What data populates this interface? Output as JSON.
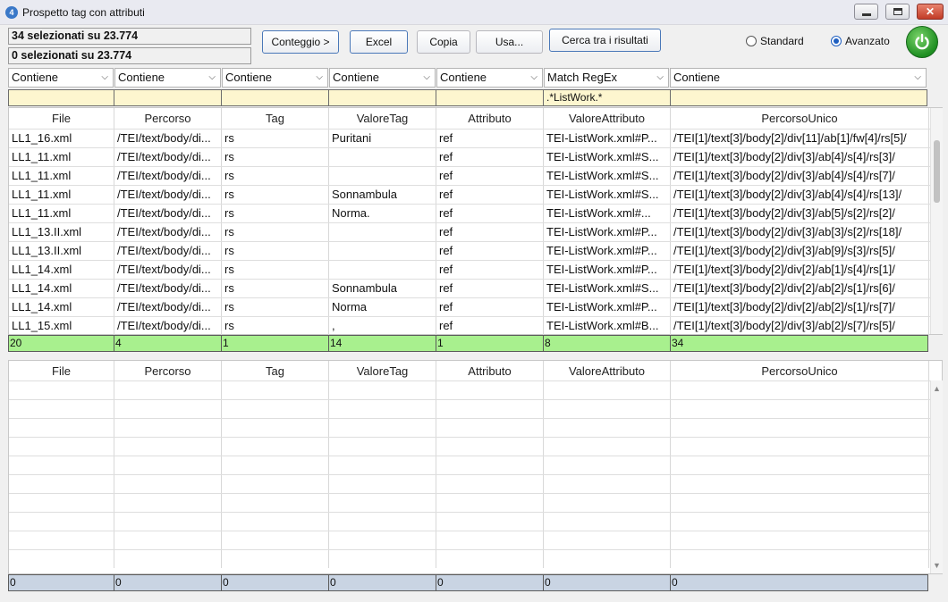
{
  "window": {
    "title": "Prospetto tag con attributi"
  },
  "status": {
    "selected_top": "34 selezionati su 23.774",
    "selected_bottom": "0 selezionati su 23.774"
  },
  "toolbar": {
    "count_label": "Conteggio >",
    "excel_label": "Excel",
    "copy_label": "Copia",
    "use_label": "Usa...",
    "search_results_label": "Cerca tra i risultati"
  },
  "mode": {
    "standard_label": "Standard",
    "advanced_label": "Avanzato",
    "selected": "Avanzato"
  },
  "filters": {
    "operators": [
      "Contiene",
      "Contiene",
      "Contiene",
      "Contiene",
      "Contiene",
      "Match RegEx",
      "Contiene"
    ],
    "values": [
      "",
      "",
      "",
      "",
      "",
      ".*ListWork.*",
      ""
    ]
  },
  "columns": [
    "File",
    "Percorso",
    "Tag",
    "ValoreTag",
    "Attributo",
    "ValoreAttributo",
    "PercorsoUnico"
  ],
  "top_rows": [
    [
      "LL1_16.xml",
      "/TEI/text/body/di...",
      "rs",
      "Puritani",
      "ref",
      "TEI-ListWork.xml#P...",
      "/TEI[1]/text[3]/body[2]/div[11]/ab[1]/fw[4]/rs[5]/"
    ],
    [
      "LL1_11.xml",
      "/TEI/text/body/di...",
      "rs",
      "",
      "ref",
      "TEI-ListWork.xml#S...",
      "/TEI[1]/text[3]/body[2]/div[3]/ab[4]/s[4]/rs[3]/"
    ],
    [
      "LL1_11.xml",
      "/TEI/text/body/di...",
      "rs",
      "",
      "ref",
      "TEI-ListWork.xml#S...",
      "/TEI[1]/text[3]/body[2]/div[3]/ab[4]/s[4]/rs[7]/"
    ],
    [
      "LL1_11.xml",
      "/TEI/text/body/di...",
      "rs",
      "Sonnambula",
      "ref",
      "TEI-ListWork.xml#S...",
      "/TEI[1]/text[3]/body[2]/div[3]/ab[4]/s[4]/rs[13]/"
    ],
    [
      "LL1_11.xml",
      "/TEI/text/body/di...",
      "rs",
      "Norma.",
      "ref",
      "TEI-ListWork.xml#...",
      "/TEI[1]/text[3]/body[2]/div[3]/ab[5]/s[2]/rs[2]/"
    ],
    [
      "LL1_13.II.xml",
      "/TEI/text/body/di...",
      "rs",
      "",
      "ref",
      "TEI-ListWork.xml#P...",
      "/TEI[1]/text[3]/body[2]/div[3]/ab[3]/s[2]/rs[18]/"
    ],
    [
      "LL1_13.II.xml",
      "/TEI/text/body/di...",
      "rs",
      "",
      "ref",
      "TEI-ListWork.xml#P...",
      "/TEI[1]/text[3]/body[2]/div[3]/ab[9]/s[3]/rs[5]/"
    ],
    [
      "LL1_14.xml",
      "/TEI/text/body/di...",
      "rs",
      "",
      "ref",
      "TEI-ListWork.xml#P...",
      "/TEI[1]/text[3]/body[2]/div[2]/ab[1]/s[4]/rs[1]/"
    ],
    [
      "LL1_14.xml",
      "/TEI/text/body/di...",
      "rs",
      "Sonnambula",
      "ref",
      "TEI-ListWork.xml#S...",
      "/TEI[1]/text[3]/body[2]/div[2]/ab[2]/s[1]/rs[6]/"
    ],
    [
      "LL1_14.xml",
      "/TEI/text/body/di...",
      "rs",
      "Norma",
      "ref",
      "TEI-ListWork.xml#P...",
      "/TEI[1]/text[3]/body[2]/div[2]/ab[2]/s[1]/rs[7]/"
    ],
    [
      "LL1_15.xml",
      "/TEI/text/body/di...",
      "rs",
      ",",
      "ref",
      "TEI-ListWork.xml#B...",
      "/TEI[1]/text[3]/body[2]/div[3]/ab[2]/s[7]/rs[5]/"
    ]
  ],
  "top_totals": [
    "20",
    "4",
    "1",
    "14",
    "1",
    "8",
    "34"
  ],
  "bottom_totals": [
    "0",
    "0",
    "0",
    "0",
    "0",
    "0",
    "0"
  ]
}
